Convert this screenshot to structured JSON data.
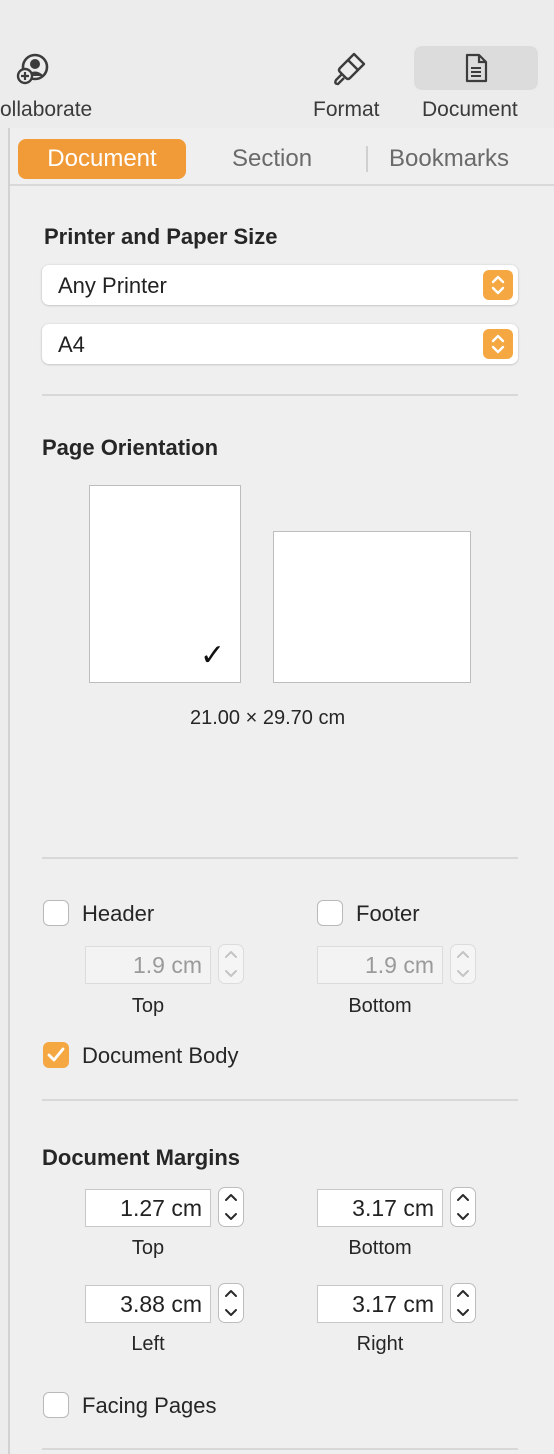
{
  "toolbar": {
    "collaborate_label": "ollaborate",
    "format_label": "Format",
    "document_label": "Document"
  },
  "tabs": {
    "document": "Document",
    "section": "Section",
    "bookmarks": "Bookmarks"
  },
  "printer": {
    "heading": "Printer and Paper Size",
    "printer_value": "Any Printer",
    "paper_value": "A4"
  },
  "orientation": {
    "heading": "Page Orientation",
    "selected": "portrait",
    "checkmark": "✓",
    "size_text": "21.00 × 29.70 cm"
  },
  "header_footer": {
    "header_label": "Header",
    "header_checked": false,
    "footer_label": "Footer",
    "footer_checked": false,
    "header_value": "1.9 cm",
    "footer_value": "1.9 cm",
    "top_label": "Top",
    "bottom_label": "Bottom",
    "body_label": "Document Body",
    "body_checked": true
  },
  "margins": {
    "heading": "Document Margins",
    "top_value": "1.27 cm",
    "top_label": "Top",
    "bottom_value": "3.17 cm",
    "bottom_label": "Bottom",
    "left_value": "3.88 cm",
    "left_label": "Left",
    "right_value": "3.17 cm",
    "right_label": "Right"
  },
  "facing_pages": {
    "label": "Facing Pages",
    "checked": false
  },
  "colors": {
    "accent": "#f19a38"
  }
}
